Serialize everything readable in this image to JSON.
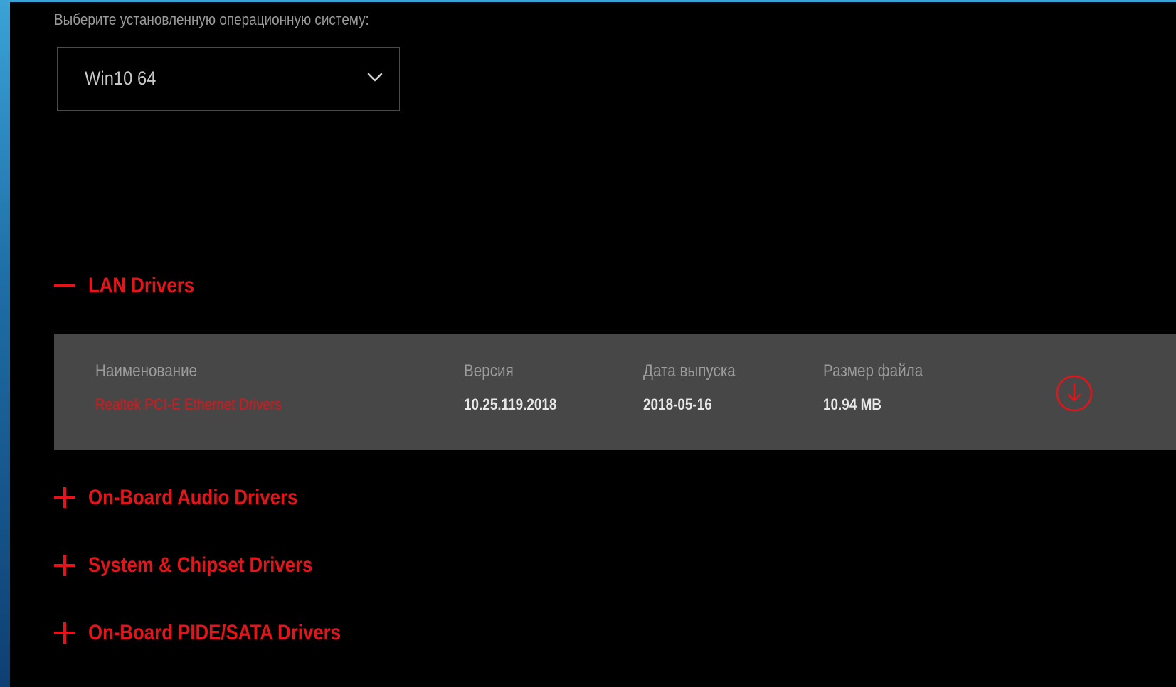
{
  "os_select": {
    "label": "Выберите установленную операционную систему:",
    "value": "Win10 64"
  },
  "sections": [
    {
      "title": "LAN Drivers",
      "expanded": true,
      "sign": "minus"
    },
    {
      "title": "On-Board Audio Drivers",
      "expanded": false,
      "sign": "plus"
    },
    {
      "title": "System & Chipset Drivers",
      "expanded": false,
      "sign": "plus"
    },
    {
      "title": "On-Board PIDE/SATA Drivers",
      "expanded": false,
      "sign": "plus"
    }
  ],
  "driver_table": {
    "headers": {
      "name": "Наименование",
      "version": "Версия",
      "date": "Дата выпуска",
      "size": "Размер файла"
    },
    "row": {
      "name": "Realtek PCI-E Ethernet Drivers",
      "version": "10.25.119.2018",
      "date": "2018-05-16",
      "size": "10.94 MB"
    }
  },
  "icons": {
    "dropdown": "chevron-down-icon",
    "download": "download-icon",
    "expand": "plus-icon",
    "collapse": "minus-icon"
  },
  "colors": {
    "accent": "#e3151b",
    "panel": "#474747",
    "background": "#000000"
  }
}
